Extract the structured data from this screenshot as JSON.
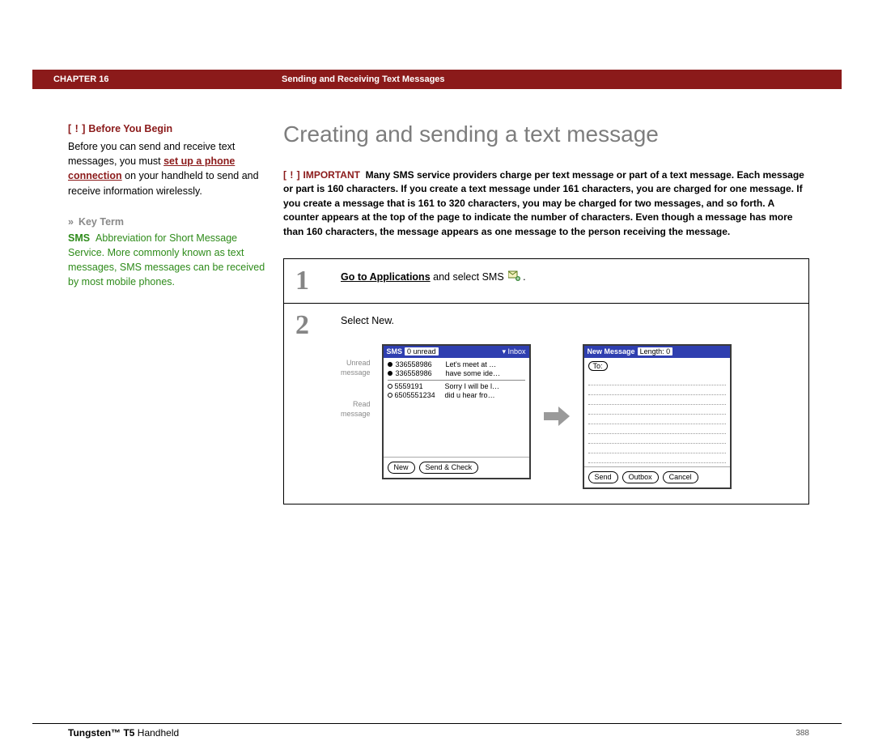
{
  "header": {
    "chapter": "CHAPTER 16",
    "title": "Sending and Receiving Text Messages"
  },
  "page_title": "Creating and sending a text message",
  "sidebar": {
    "before_you_begin": {
      "label": "Before You Begin",
      "bracket": "[ ! ]",
      "body_pre": "Before you can send and receive text messages, you must ",
      "link": "set up a phone connection",
      "body_post": " on your handheld to send and receive information wirelessly."
    },
    "key_term": {
      "label": "Key Term",
      "term": "SMS",
      "body": "Abbreviation for Short Message Service. More commonly known as text messages, SMS messages can be received by most mobile phones."
    }
  },
  "important": {
    "bracket": "[ ! ]",
    "label": "IMPORTANT",
    "body": "Many SMS service providers charge per text message or part of a text message. Each message or part is 160 characters. If you create a text message under 161 characters, you are charged for one message. If you create a message that is 161 to 320 characters, you may be charged for two messages, and so forth. A counter appears at the top of the page to indicate the number of characters. Even though a message has more than 160 characters, the message appears as one message to the person receiving the message."
  },
  "steps": [
    {
      "num": "1",
      "text_pre": "Go to Applications",
      "text_post": " and select SMS"
    },
    {
      "num": "2",
      "text": "Select New."
    }
  ],
  "callouts": {
    "unread": "Unread message",
    "read": "Read message"
  },
  "screen1": {
    "title": "SMS",
    "unread_badge": "0 unread",
    "dropdown": "Inbox",
    "rows": [
      {
        "unread": true,
        "num": "336558986",
        "prev": "Let's meet at …"
      },
      {
        "unread": true,
        "num": "336558986",
        "prev": "have some ide…"
      },
      {
        "unread": false,
        "num": "5559191",
        "prev": "Sorry I will be l…"
      },
      {
        "unread": false,
        "num": "6505551234",
        "prev": "did u hear fro…"
      }
    ],
    "buttons": [
      "New",
      "Send & Check"
    ]
  },
  "screen2": {
    "title": "New Message",
    "length_label": "Length: 0",
    "to_btn": "To:",
    "buttons": [
      "Send",
      "Outbox",
      "Cancel"
    ]
  },
  "footer": {
    "product_bold": "Tungsten™ T5",
    "product_rest": " Handheld",
    "page": "388"
  }
}
